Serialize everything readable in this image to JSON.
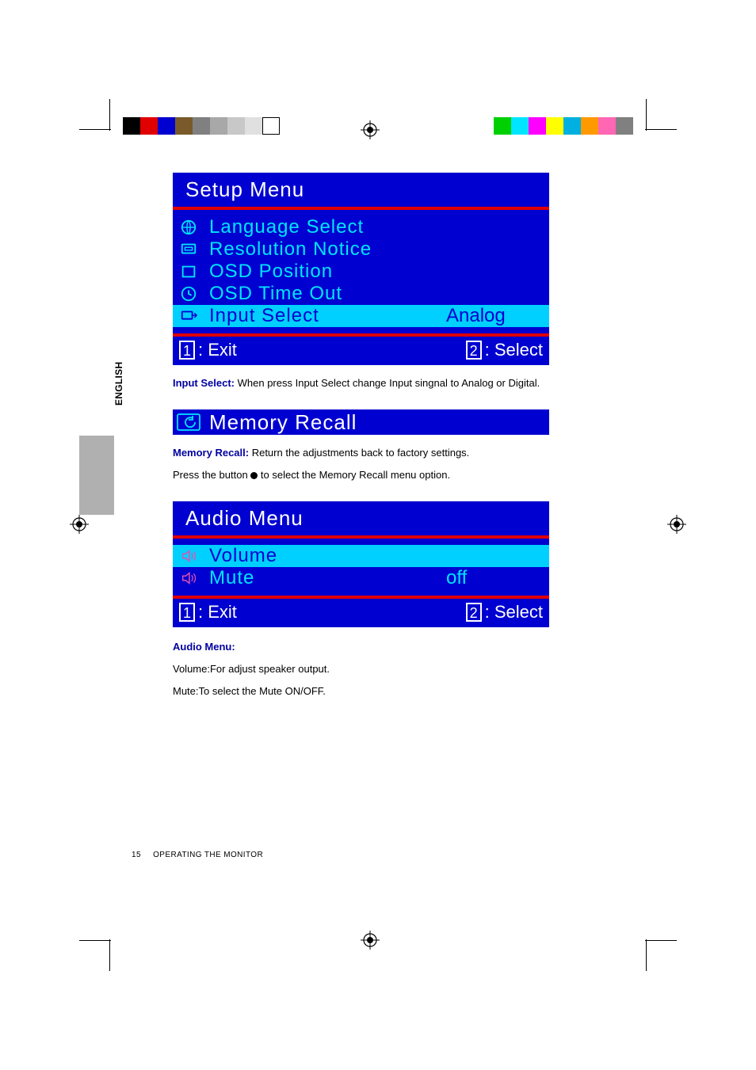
{
  "sideLabel": "ENGLISH",
  "setupMenu": {
    "title": "Setup Menu",
    "items": [
      {
        "label": "Language Select",
        "value": "",
        "icon": "globe"
      },
      {
        "label": "Resolution Notice",
        "value": "",
        "icon": "screen"
      },
      {
        "label": "OSD Position",
        "value": "",
        "icon": "box"
      },
      {
        "label": "OSD Time Out",
        "value": "",
        "icon": "clock"
      },
      {
        "label": "Input Select",
        "value": "Analog",
        "icon": "input",
        "selected": true
      }
    ],
    "footer": {
      "key1": "1",
      "label1": ": Exit",
      "key2": "2",
      "label2": ": Select"
    }
  },
  "inputSelectDesc": {
    "label": "Input Select:",
    "text": " When press Input Select change Input singnal to Analog or Digital."
  },
  "memoryRecall": {
    "title": "Memory Recall",
    "descLabel": "Memory Recall:",
    "descText": " Return the adjustments back to factory settings.",
    "pressLine1": "Press the button ",
    "pressLine2": " to select the Memory Recall menu option."
  },
  "audioMenu": {
    "title": "Audio Menu",
    "items": [
      {
        "label": "Volume",
        "value": "",
        "icon": "speaker",
        "selected": true
      },
      {
        "label": "Mute",
        "value": "off",
        "icon": "speaker"
      }
    ],
    "footer": {
      "key1": "1",
      "label1": ": Exit",
      "key2": "2",
      "label2": ": Select"
    }
  },
  "audioDesc": {
    "label": "Audio Menu:",
    "line1": "Volume:For adjust speaker output.",
    "line2": "Mute:To select the Mute ON/OFF."
  },
  "pageFooter": {
    "num": "15",
    "text": "OPERATING THE MONITOR"
  },
  "colors": {
    "leftBar": [
      "#000000",
      "#e00000",
      "#0000d0",
      "#7a5a2a",
      "#808080",
      "#a8a8a8",
      "#c8c8c8",
      "#e0e0e0",
      "#ffffff"
    ],
    "rightBar": [
      "#808080",
      "#ff66b3",
      "#ff9900",
      "#00b0e0",
      "#ffff00",
      "#ff00ff",
      "#00e5ff",
      "#00d000"
    ]
  }
}
